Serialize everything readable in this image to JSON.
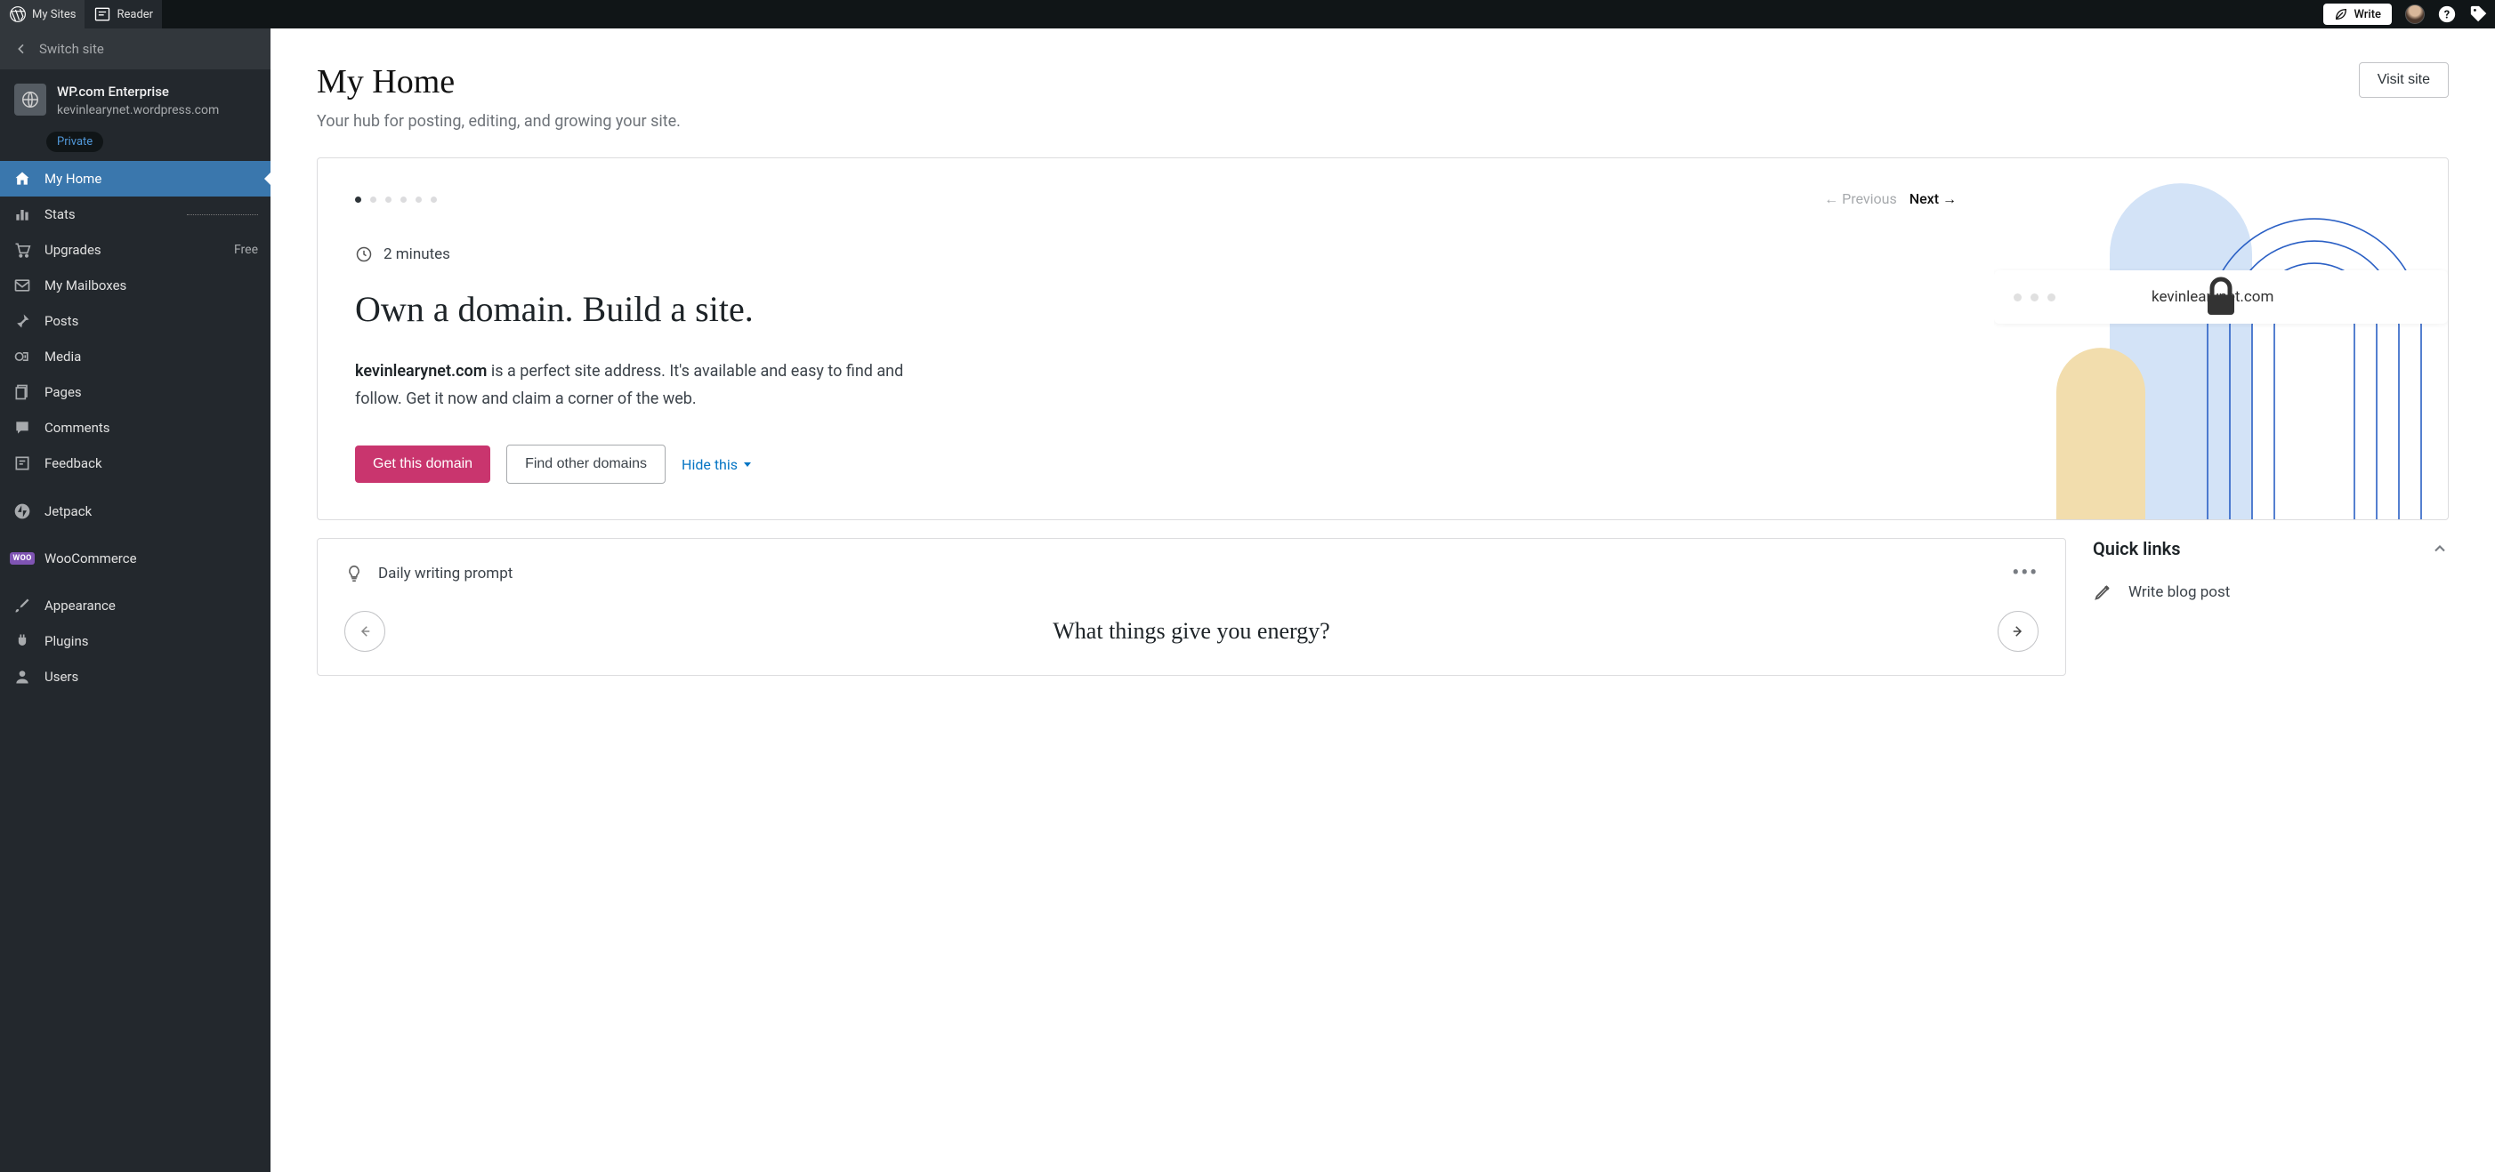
{
  "topbar": {
    "my_sites": "My Sites",
    "reader": "Reader",
    "write": "Write"
  },
  "sidebar": {
    "switch_site": "Switch site",
    "site_name": "WP.com Enterprise",
    "site_url": "kevinlearynet.wordpress.com",
    "private": "Private",
    "items": {
      "my_home": "My Home",
      "stats": "Stats",
      "upgrades": "Upgrades",
      "upgrades_badge": "Free",
      "mailboxes": "My Mailboxes",
      "posts": "Posts",
      "media": "Media",
      "pages": "Pages",
      "comments": "Comments",
      "feedback": "Feedback",
      "jetpack": "Jetpack",
      "woocommerce": "WooCommerce",
      "woo_badge": "WOO",
      "appearance": "Appearance",
      "plugins": "Plugins",
      "users": "Users"
    }
  },
  "page": {
    "title": "My Home",
    "subtitle": "Your hub for posting, editing, and growing your site.",
    "visit": "Visit site"
  },
  "domain_card": {
    "prev": "Previous",
    "next": "Next",
    "time": "2 minutes",
    "title": "Own a domain. Build a site.",
    "domain_name": "kevinlearynet.com",
    "desc_rest": " is a perfect site address. It's available and easy to find and follow. Get it now and claim a corner of the web.",
    "get_btn": "Get this domain",
    "find_btn": "Find other domains",
    "hide": "Hide this",
    "addr_text": "kevinlearynet.com"
  },
  "prompt": {
    "label": "Daily writing prompt",
    "question": "What things give you energy?"
  },
  "quick": {
    "title": "Quick links",
    "write_post": "Write blog post"
  }
}
